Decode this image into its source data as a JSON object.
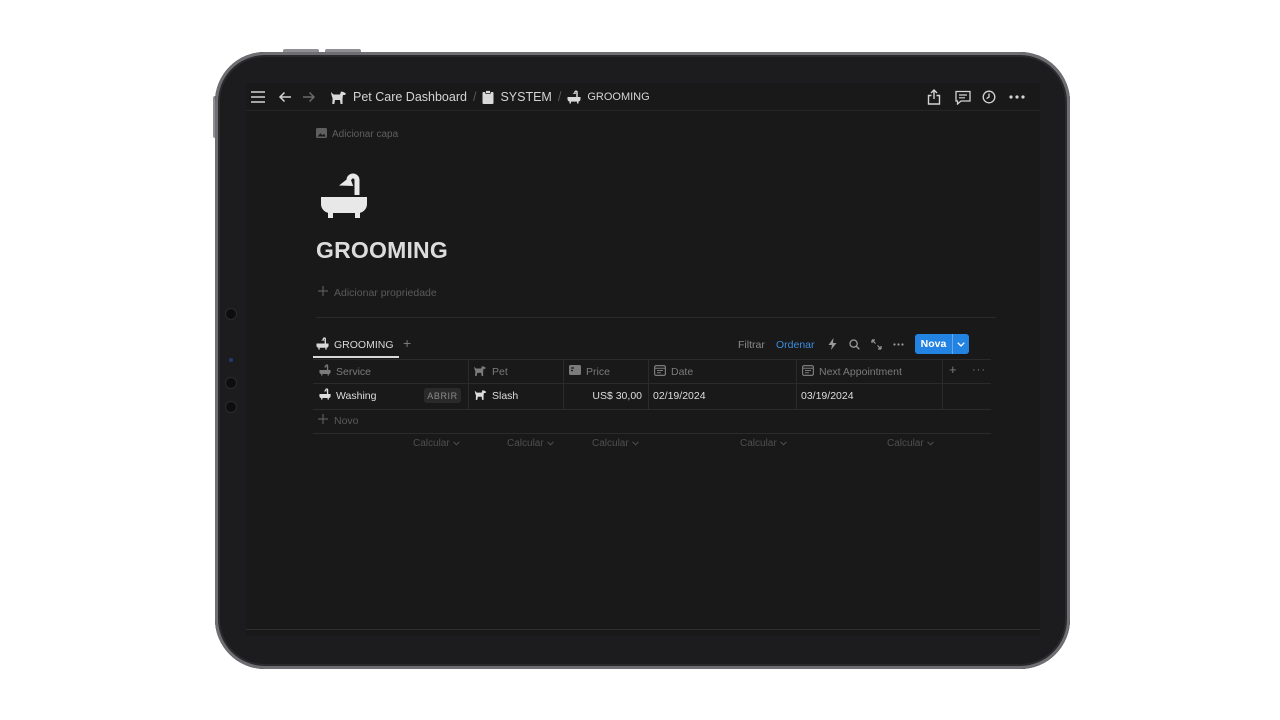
{
  "breadcrumb": [
    {
      "icon": "dog-icon",
      "label": "Pet Care Dashboard"
    },
    {
      "icon": "clipboard-icon",
      "label": "SYSTEM"
    },
    {
      "icon": "bathtub-icon",
      "label": "GROOMING"
    }
  ],
  "page": {
    "cover_link": "Adicionar capa",
    "icon": "bathtub-icon",
    "title": "GROOMING",
    "add_property": "Adicionar propriedade"
  },
  "view": {
    "tab_label": "GROOMING",
    "filter_label": "Filtrar",
    "sort_label": "Ordenar",
    "new_label": "Nova"
  },
  "table": {
    "columns": [
      {
        "icon": "bathtub-icon",
        "label": "Service"
      },
      {
        "icon": "dog-icon",
        "label": "Pet"
      },
      {
        "icon": "price-icon",
        "label": "Price"
      },
      {
        "icon": "calendar-icon",
        "label": "Date"
      },
      {
        "icon": "calendar-icon",
        "label": "Next Appointment"
      }
    ],
    "rows": [
      {
        "service": "Washing",
        "open_label": "ABRIR",
        "pet": "Slash",
        "price": "US$ 30,00",
        "date": "02/19/2024",
        "next_appointment": "03/19/2024"
      }
    ],
    "new_row_label": "Novo",
    "calc_label": "Calcular"
  },
  "colors": {
    "accent": "#2383e2",
    "link": "#3c8cde",
    "background": "#191919"
  }
}
